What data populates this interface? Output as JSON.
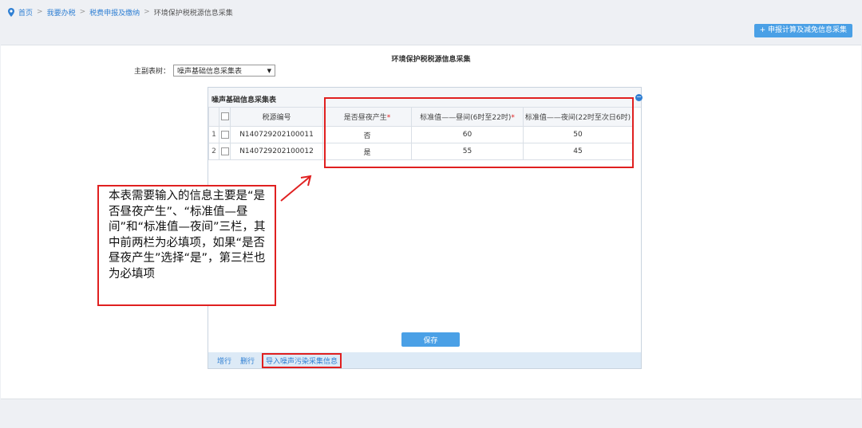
{
  "breadcrumb": {
    "home": "首页",
    "level1": "我要办税",
    "level2": "税费申报及缴纳",
    "current": "环境保护税税源信息采集",
    "separator": ">"
  },
  "top_button": "+ 申报计算及减免信息采集",
  "panel_title": "环境保护税税源信息采集",
  "selector": {
    "label": "主副表树：",
    "value": "噪声基础信息采集表"
  },
  "grid": {
    "title": "噪声基础信息采集表",
    "columns": [
      "税源编号",
      "是否昼夜产生",
      "标准值——昼间(6时至22时)",
      "标准值——夜间(22时至次日6时)"
    ],
    "required_mark": "*",
    "rows": [
      {
        "num": "1",
        "id": "N140729202100011",
        "daynight": "否",
        "day": "60",
        "night": "50"
      },
      {
        "num": "2",
        "id": "N140729202100012",
        "daynight": "是",
        "day": "55",
        "night": "45"
      }
    ],
    "footer": {
      "add": "增行",
      "delete": "删行",
      "import": "导入噪声污染采集信息"
    }
  },
  "save_button": "保存",
  "annotation": "本表需要输入的信息主要是“是否昼夜产生”、“标准值—昼间”和“标准值—夜间”三栏，其中前两栏为必填项，如果“是否昼夜产生”选择“是”，第三栏也为必填项",
  "colors": {
    "accent": "#4aa0e6",
    "link": "#2f7fd3",
    "highlight": "#e02020"
  }
}
